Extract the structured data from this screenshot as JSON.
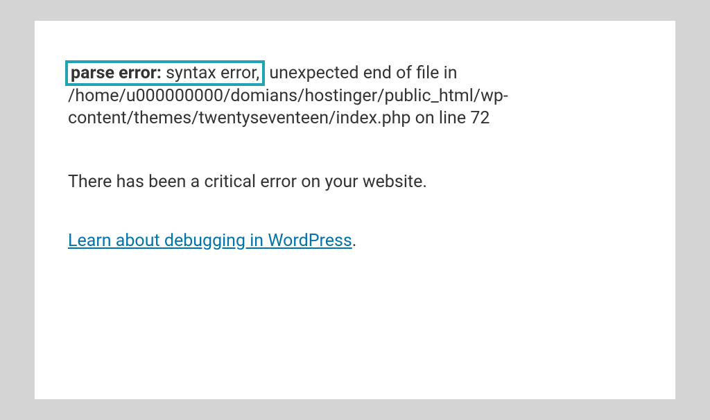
{
  "error": {
    "highlighted_bold": "parse error:",
    "highlighted_rest": " syntax error,",
    "remainder": " unexpected end of file in /home/u000000000/domians/hostinger/public_html/wp-content/themes/twentyseventeen/index.php on line 72"
  },
  "critical_message": "There has been a critical error on your website.",
  "link": {
    "text": "Learn about debugging in WordPress",
    "period": "."
  }
}
